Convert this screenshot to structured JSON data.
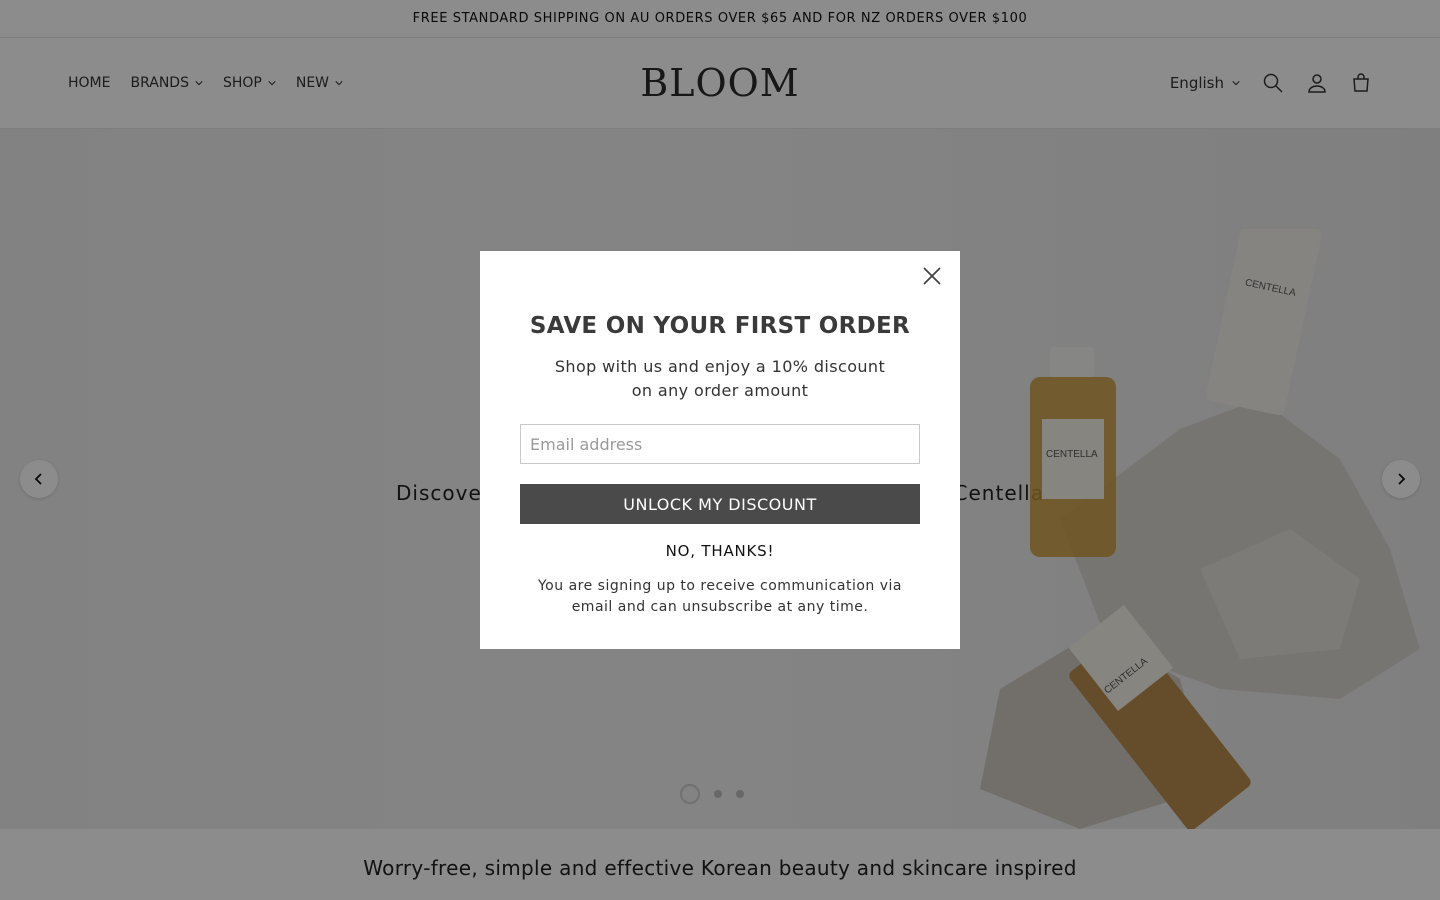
{
  "announcement": {
    "text": "FREE STANDARD SHIPPING ON AU ORDERS OVER $65 AND FOR NZ ORDERS OVER $100"
  },
  "header": {
    "logo": "BLOOM",
    "nav": [
      {
        "label": "HOME",
        "has_dropdown": false
      },
      {
        "label": "BRANDS",
        "has_dropdown": true
      },
      {
        "label": "SHOP",
        "has_dropdown": true
      },
      {
        "label": "NEW",
        "has_dropdown": true
      }
    ],
    "language": "English",
    "icons": [
      "search-icon",
      "account-icon",
      "cart-icon"
    ]
  },
  "hero": {
    "text_left": "Discover",
    "text_right": "Centella",
    "product_labels": [
      "CENTELLA",
      "CENTELLA",
      "CENTELLA"
    ],
    "slides": 3,
    "active_slide": 1
  },
  "below": {
    "text": "Worry-free, simple and effective Korean beauty and skincare inspired"
  },
  "modal": {
    "title": "SAVE ON YOUR FIRST ORDER",
    "subtitle_line1": "Shop with us and enjoy a 10% discount",
    "subtitle_line2": "on any order amount",
    "email_placeholder": "Email address",
    "unlock_label": "UNLOCK MY DISCOUNT",
    "no_thanks_label": "NO, THANKS!",
    "disclaimer": "You are signing up to receive communication via email and can unsubscribe at any time."
  },
  "colors": {
    "button_bg": "#4a4a4a",
    "overlay": "rgba(0,0,0,0.45)"
  }
}
